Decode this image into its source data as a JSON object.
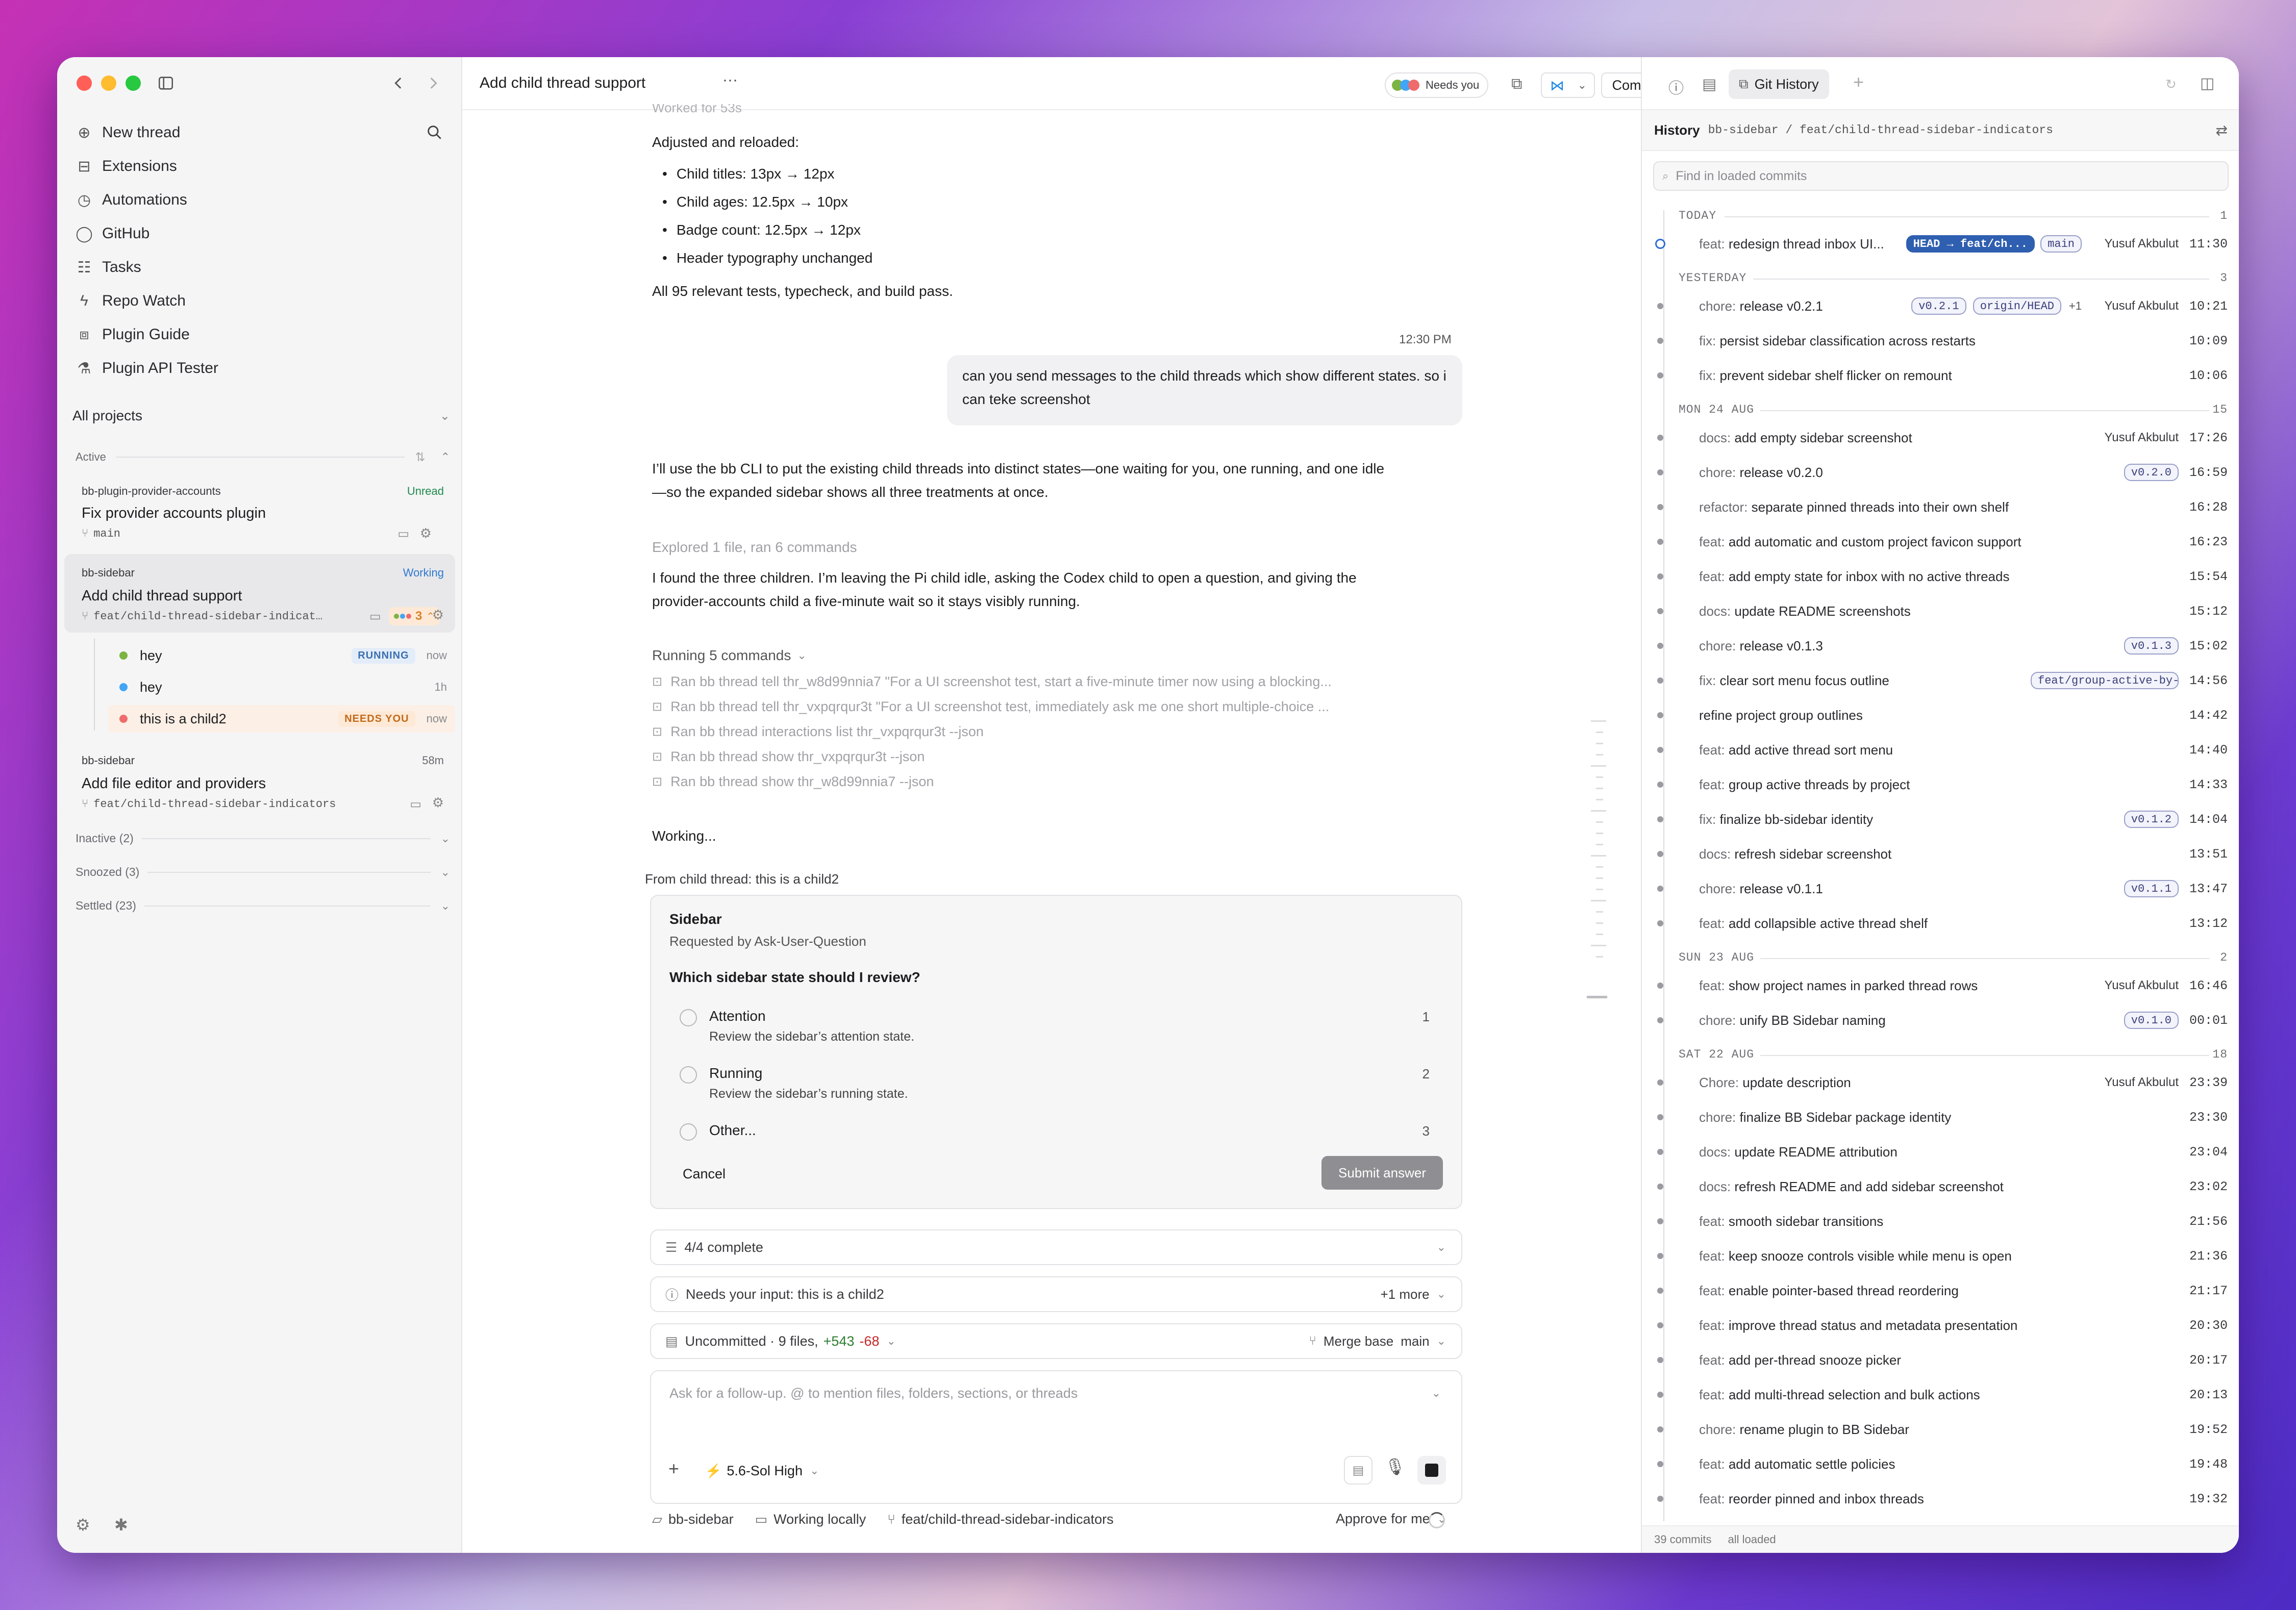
{
  "sidebar": {
    "nav": [
      {
        "label": "New thread",
        "icon": "plus-circle-icon"
      },
      {
        "label": "Extensions",
        "icon": "briefcase-icon"
      },
      {
        "label": "Automations",
        "icon": "clock-icon"
      },
      {
        "label": "GitHub",
        "icon": "github-icon"
      },
      {
        "label": "Tasks",
        "icon": "tasks-icon"
      },
      {
        "label": "Repo Watch",
        "icon": "bolt-icon"
      },
      {
        "label": "Plugin Guide",
        "icon": "puzzle-icon"
      },
      {
        "label": "Plugin API Tester",
        "icon": "flask-icon"
      }
    ],
    "projects_label": "All projects",
    "active_label": "Active",
    "threads": [
      {
        "project": "bb-plugin-provider-accounts",
        "status": "Unread",
        "title": "Fix provider accounts plugin",
        "branch": "main"
      },
      {
        "project": "bb-sidebar",
        "status": "Working",
        "title": "Add child thread support",
        "branch": "feat/child-thread-sidebar-indicat…",
        "count": "3"
      },
      {
        "project": "bb-sidebar",
        "status": "58m",
        "title": "Add file editor and providers",
        "branch": "feat/child-thread-sidebar-indicators"
      }
    ],
    "children": [
      {
        "title": "hey",
        "badge": "RUNNING",
        "time": "now",
        "color": "#7cb342"
      },
      {
        "title": "hey",
        "badge": "",
        "time": "1h",
        "color": "#42a5f5"
      },
      {
        "title": "this is a child2",
        "badge": "NEEDS YOU",
        "time": "now",
        "color": "#ef6c6c"
      }
    ],
    "sections": [
      "Inactive (2)",
      "Snoozed (3)",
      "Settled (23)"
    ]
  },
  "header": {
    "title": "Add child thread support",
    "needs_you": "Needs you",
    "commit_label": "Commit"
  },
  "chat": {
    "worked_for": "Worked for 53s",
    "adjusted": "Adjusted and reloaded:",
    "bullets": [
      "Child titles: 13px → 12px",
      "Child ages: 12.5px → 10px",
      "Badge count: 12.5px → 12px",
      "Header typography unchanged"
    ],
    "tests": "All 95 relevant tests, typecheck, and build pass.",
    "time": "12:30 PM",
    "user_msg_1": "can you send messages to the child threads which show different states. so i",
    "user_msg_2": "can teke screenshot",
    "reply_1": "I’ll use the bb CLI to put the existing child threads into distinct states—one waiting for you, one running, and one idle",
    "reply_2": "—so the expanded sidebar shows all three treatments at once.",
    "explored": "Explored 1 file, ran 6 commands",
    "found_1": "I found the three children. I’m leaving the Pi child idle, asking the Codex child to open a question, and giving the",
    "found_2": "provider-accounts child a five-minute wait so it stays visibly running.",
    "running": "Running 5 commands",
    "commands": [
      "Ran bb thread tell thr_w8d99nnia7 \"For a UI screenshot test, start a five-minute timer now using a blocking...",
      "Ran bb thread tell thr_vxpqrqur3t \"For a UI screenshot test, immediately ask me one short multiple-choice ...",
      "Ran bb thread interactions list thr_vxpqrqur3t --json",
      "Ran bb thread show thr_vxpqrqur3t --json",
      "Ran bb thread show thr_w8d99nnia7 --json"
    ],
    "working": "Working...",
    "from_child": "From child thread: this is a child2"
  },
  "question": {
    "title": "Sidebar",
    "requested": "Requested by Ask-User-Question",
    "prompt": "Which sidebar state should I review?",
    "options": [
      {
        "label": "Attention",
        "desc": "Review the sidebar’s attention state.",
        "num": "1"
      },
      {
        "label": "Running",
        "desc": "Review the sidebar’s running state.",
        "num": "2"
      },
      {
        "label": "Other...",
        "desc": "",
        "num": "3"
      }
    ],
    "cancel": "Cancel",
    "submit": "Submit answer"
  },
  "status_rows": {
    "complete": "4/4 complete",
    "needs_input": "Needs your input: this is a child2",
    "more": "+1 more",
    "uncommitted": "Uncommitted · 9 files,",
    "added": "+543",
    "removed": "-68",
    "merge_base": "Merge base",
    "merge_branch": "main"
  },
  "composer": {
    "placeholder": "Ask for a follow-up. @ to mention files, folders, sections, or threads",
    "model": "5.6-Sol High"
  },
  "footer": {
    "project": "bb-sidebar",
    "location": "Working locally",
    "branch": "feat/child-thread-sidebar-indicators",
    "approve": "Approve for me"
  },
  "git": {
    "tab": "Git History",
    "history_label": "History",
    "repo_path": "bb-sidebar / feat/child-thread-sidebar-indicators",
    "search_placeholder": "Find in loaded commits",
    "footer_count": "39 commits",
    "footer_loaded": "all loaded",
    "groups": [
      {
        "day": "TODAY",
        "count": "1",
        "commits": [
          {
            "pre": "feat:",
            "msg": "redesign thread inbox UI...",
            "tags": [
              "HEAD → feat/ch...",
              "main"
            ],
            "author": "Yusuf Akbulut",
            "time": "11:30",
            "head": true
          }
        ]
      },
      {
        "day": "YESTERDAY",
        "count": "3",
        "commits": [
          {
            "pre": "chore:",
            "msg": "release v0.2.1",
            "tags": [
              "v0.2.1",
              "origin/HEAD"
            ],
            "extra": "+1",
            "author": "Yusuf Akbulut",
            "time": "10:21"
          },
          {
            "pre": "fix:",
            "msg": "persist sidebar classification across restarts",
            "time": "10:09"
          },
          {
            "pre": "fix:",
            "msg": "prevent sidebar shelf flicker on remount",
            "time": "10:06"
          }
        ]
      },
      {
        "day": "MON 24 AUG",
        "count": "15",
        "commits": [
          {
            "pre": "docs:",
            "msg": "add empty sidebar screenshot",
            "author": "Yusuf Akbulut",
            "time": "17:26"
          },
          {
            "pre": "chore:",
            "msg": "release v0.2.0",
            "tags": [
              "v0.2.0"
            ],
            "time": "16:59"
          },
          {
            "pre": "refactor:",
            "msg": "separate pinned threads into their own shelf",
            "time": "16:28"
          },
          {
            "pre": "feat:",
            "msg": "add automatic and custom project favicon support",
            "time": "16:23"
          },
          {
            "pre": "feat:",
            "msg": "add empty state for inbox with no active threads",
            "time": "15:54"
          },
          {
            "pre": "docs:",
            "msg": "update README screenshots",
            "time": "15:12"
          },
          {
            "pre": "chore:",
            "msg": "release v0.1.3",
            "tags": [
              "v0.1.3"
            ],
            "time": "15:02"
          },
          {
            "pre": "fix:",
            "msg": "clear sort menu focus outline",
            "tags": [
              "feat/group-active-by-..."
            ],
            "time": "14:56"
          },
          {
            "pre": "",
            "msg": "refine project group outlines",
            "time": "14:42"
          },
          {
            "pre": "feat:",
            "msg": "add active thread sort menu",
            "time": "14:40"
          },
          {
            "pre": "feat:",
            "msg": "group active threads by project",
            "time": "14:33"
          },
          {
            "pre": "fix:",
            "msg": "finalize bb-sidebar identity",
            "tags": [
              "v0.1.2"
            ],
            "time": "14:04"
          },
          {
            "pre": "docs:",
            "msg": "refresh sidebar screenshot",
            "time": "13:51"
          },
          {
            "pre": "chore:",
            "msg": "release v0.1.1",
            "tags": [
              "v0.1.1"
            ],
            "time": "13:47"
          },
          {
            "pre": "feat:",
            "msg": "add collapsible active thread shelf",
            "time": "13:12"
          }
        ]
      },
      {
        "day": "SUN 23 AUG",
        "count": "2",
        "commits": [
          {
            "pre": "feat:",
            "msg": "show project names in parked thread rows",
            "author": "Yusuf Akbulut",
            "time": "16:46"
          },
          {
            "pre": "chore:",
            "msg": "unify BB Sidebar naming",
            "tags": [
              "v0.1.0"
            ],
            "time": "00:01"
          }
        ]
      },
      {
        "day": "SAT 22 AUG",
        "count": "18",
        "commits": [
          {
            "pre": "Chore:",
            "msg": "update description",
            "author": "Yusuf Akbulut",
            "time": "23:39"
          },
          {
            "pre": "chore:",
            "msg": "finalize BB Sidebar package identity",
            "time": "23:30"
          },
          {
            "pre": "docs:",
            "msg": "update README attribution",
            "time": "23:04"
          },
          {
            "pre": "docs:",
            "msg": "refresh README and add sidebar screenshot",
            "time": "23:02"
          },
          {
            "pre": "feat:",
            "msg": "smooth sidebar transitions",
            "time": "21:56"
          },
          {
            "pre": "feat:",
            "msg": "keep snooze controls visible while menu is open",
            "time": "21:36"
          },
          {
            "pre": "feat:",
            "msg": "enable pointer-based thread reordering",
            "time": "21:17"
          },
          {
            "pre": "feat:",
            "msg": "improve thread status and metadata presentation",
            "time": "20:30"
          },
          {
            "pre": "feat:",
            "msg": "add per-thread snooze picker",
            "time": "20:17"
          },
          {
            "pre": "feat:",
            "msg": "add multi-thread selection and bulk actions",
            "time": "20:13"
          },
          {
            "pre": "chore:",
            "msg": "rename plugin to BB Sidebar",
            "time": "19:52"
          },
          {
            "pre": "feat:",
            "msg": "add automatic settle policies",
            "time": "19:48"
          },
          {
            "pre": "feat:",
            "msg": "reorder pinned and inbox threads",
            "time": "19:32"
          }
        ]
      }
    ]
  }
}
